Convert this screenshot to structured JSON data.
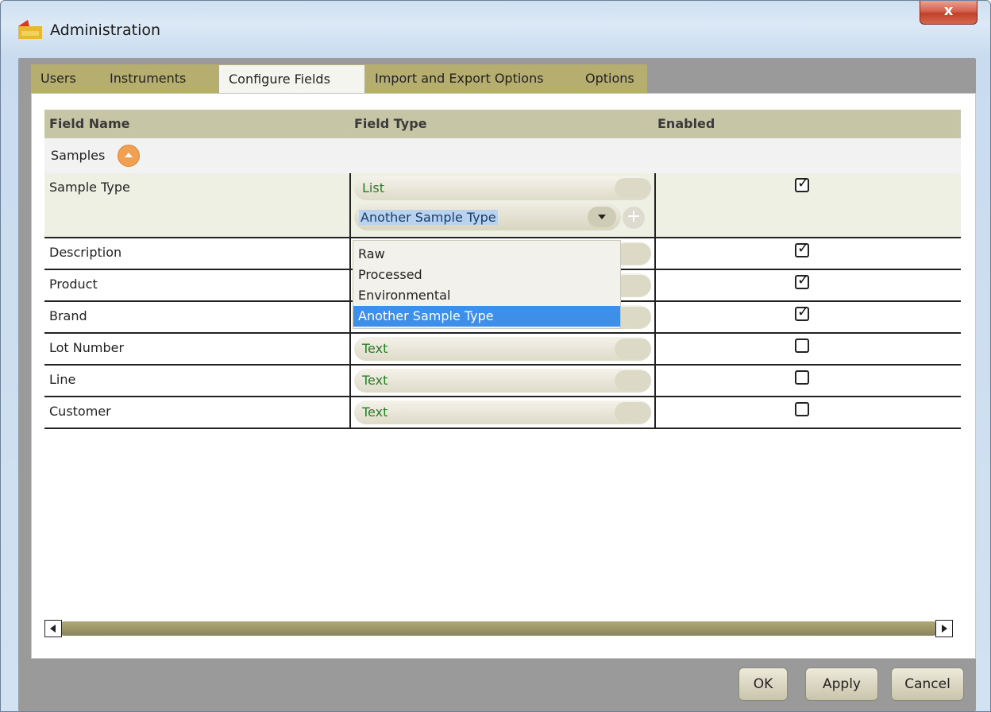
{
  "window": {
    "title": "Administration",
    "close_glyph": "x"
  },
  "tabs": [
    {
      "label": "Users"
    },
    {
      "label": "Instruments"
    },
    {
      "label": "Configure Fields",
      "active": true
    },
    {
      "label": "Import and Export Options"
    },
    {
      "label": "Options"
    }
  ],
  "grid": {
    "columns": {
      "name": "Field Name",
      "type": "Field Type",
      "enabled": "Enabled"
    },
    "group": {
      "label": "Samples"
    },
    "rows": [
      {
        "name": "Sample Type",
        "type": "List",
        "enabled": true,
        "list_value": "Another Sample Type"
      },
      {
        "name": "Description",
        "type": "",
        "enabled": true
      },
      {
        "name": "Product",
        "type": "",
        "enabled": true
      },
      {
        "name": "Brand",
        "type": "",
        "enabled": true
      },
      {
        "name": "Lot Number",
        "type": "Text",
        "enabled": false
      },
      {
        "name": "Line",
        "type": "Text",
        "enabled": false
      },
      {
        "name": "Customer",
        "type": "Text",
        "enabled": false
      }
    ]
  },
  "dropdown": {
    "options": [
      "Raw",
      "Processed",
      "Environmental",
      "Another Sample Type"
    ],
    "selected": "Another Sample Type"
  },
  "buttons": {
    "ok": "OK",
    "apply": "Apply",
    "cancel": "Cancel"
  },
  "checkmark": "✓",
  "colors": {
    "tab_bg": "#b6ae6f",
    "header_bg": "#c6c5a6",
    "type_text": "#2a7a2a",
    "selection": "#3d8fea"
  }
}
